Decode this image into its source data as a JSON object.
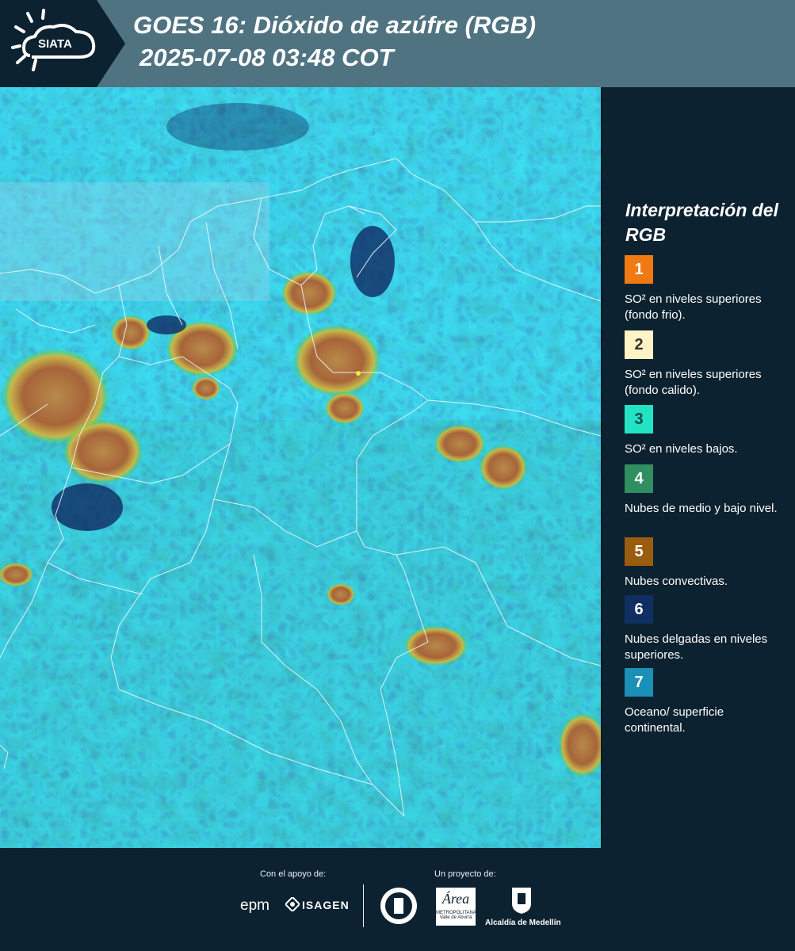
{
  "header": {
    "brand": "SIATA",
    "title_line1": "GOES 16: Dióxido de azúfre (RGB)",
    "title_line2": "2025-07-08 03:48 COT"
  },
  "legend": {
    "title": "Interpretación del RGB",
    "items": [
      {
        "number": "1",
        "label": "SO² en niveles superiores (fondo frio).",
        "color": "#f07a12"
      },
      {
        "number": "2",
        "label": "SO² en niveles superiores (fondo calido).",
        "color": "#fdf3c4"
      },
      {
        "number": "3",
        "label": "SO² en niveles bajos.",
        "color": "#22e4c4"
      },
      {
        "number": "4",
        "label": "Nubes de medio y bajo nivel.",
        "color": "#2f8f60"
      },
      {
        "number": "5",
        "label": "Nubes convectivas.",
        "color": "#9a5d10"
      },
      {
        "number": "6",
        "label": "Nubes delgadas en niveles superiores.",
        "color": "#0f2f63"
      },
      {
        "number": "7",
        "label": "Oceano/ superficie continental.",
        "color": "#1a8fb8"
      }
    ]
  },
  "footer": {
    "support_label": "Con el apoyo de:",
    "project_label": "Un proyecto de:",
    "sponsor1": "epm",
    "sponsor2": "ISAGEN",
    "partner1": "Área",
    "partner1_sub": "METROPOLITANA",
    "partner1_sub2": "Valle de Aburrá",
    "partner2": "Alcaldía de Medellín"
  }
}
